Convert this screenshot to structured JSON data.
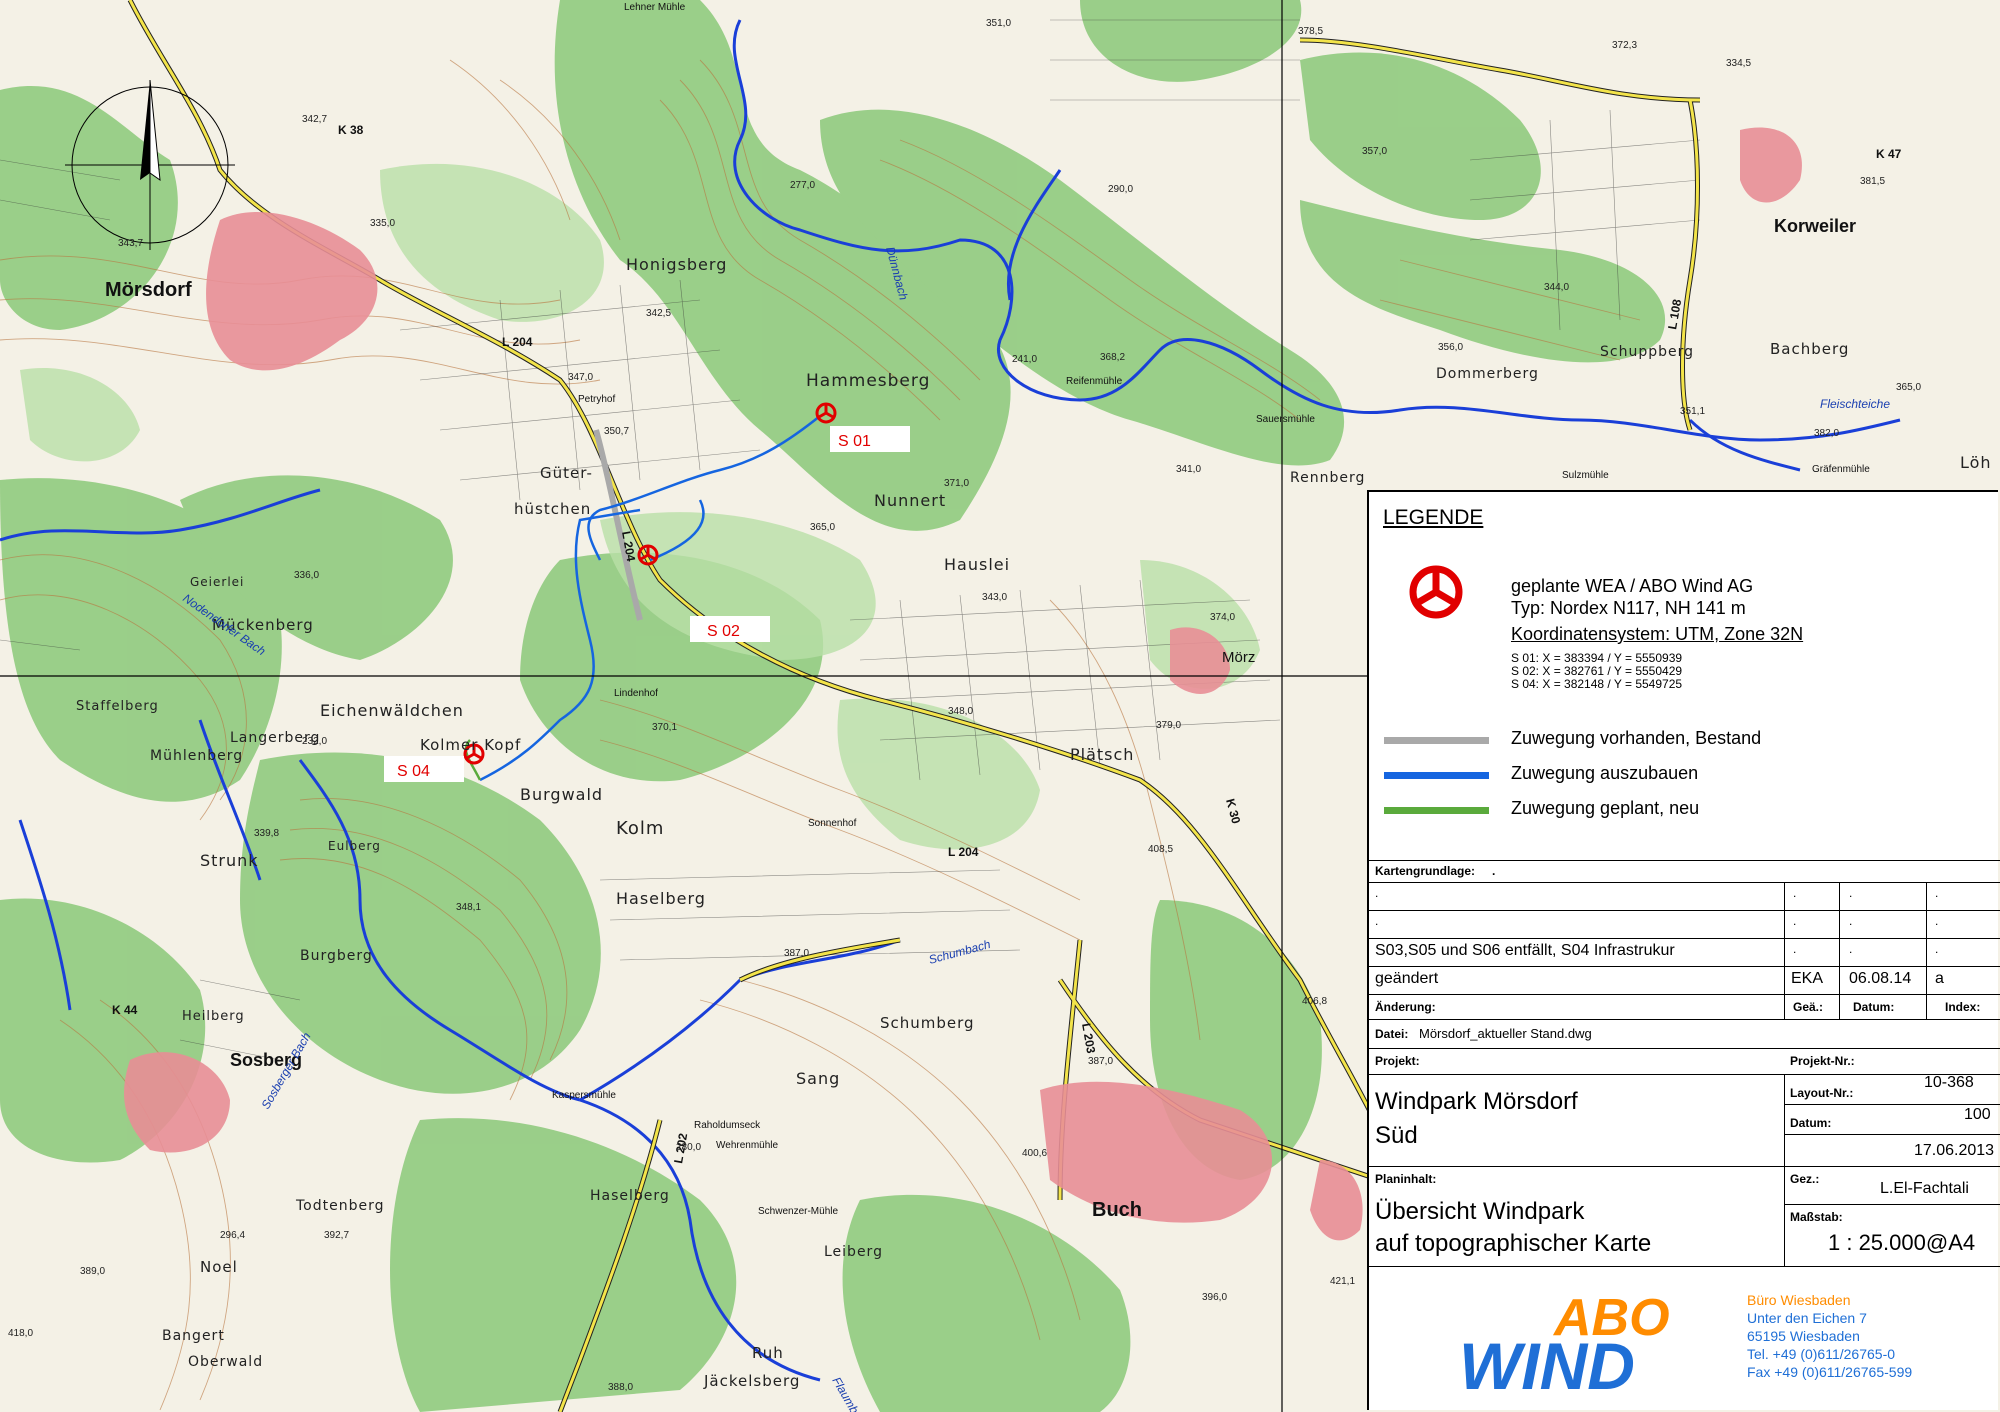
{
  "map": {
    "towns": [
      "Mörsdorf",
      "Korweiler",
      "Sosberg",
      "Buch",
      "Mörz"
    ],
    "places": [
      "Honigsberg",
      "Hammesberg",
      "Güter-",
      "hüstchen",
      "Nunnert",
      "Hauslei",
      "Geierlei",
      "Mückenberg",
      "Eichenwäldchen",
      "Kolmer Kopf",
      "Burgwald",
      "Kolm",
      "Haselberg",
      "Strunk",
      "Mühlenberg",
      "Langerberg",
      "Heilberg",
      "Burgberg",
      "Schumberg",
      "Sang",
      "Haselberg",
      "Todtenberg",
      "Noel",
      "Bangert",
      "Oberwald",
      "Ruh",
      "Jäckelsberg",
      "Leiberg",
      "Plätsch",
      "Rennberg",
      "Bachberg",
      "Schuppberg",
      "Dommerberg",
      "Löh",
      "Staffelberg",
      "Eulberg"
    ],
    "farms": [
      "Petryhof",
      "Lindenhof",
      "Sonnenhof",
      "Reifenmühle",
      "Sauersmühle",
      "Sulzmühle",
      "Gräfenmühle",
      "Kaspersmühle",
      "Raholdumseck",
      "Wehrenmühle",
      "Schwenzer-Mühle",
      "Lehner Mühle"
    ],
    "creeks": [
      "Dünnbach",
      "Schumbach",
      "Sosberger Bach",
      "Flaumbach",
      "Nodendorfer Bach",
      "Fleischteiche"
    ],
    "roads": [
      "L 204",
      "K 38",
      "L 204",
      "L 204",
      "K 47",
      "L 108",
      "K 30",
      "L 203",
      "L 202",
      "K 44"
    ],
    "elevations": [
      "342,7",
      "343,7",
      "335,0",
      "347,0",
      "350,7",
      "342,5",
      "277,0",
      "351,0",
      "378,5",
      "372,3",
      "334,5",
      "357,0",
      "290,0",
      "381,5",
      "344,0",
      "356,0",
      "241,0",
      "368,2",
      "351,1",
      "365,0",
      "341,0",
      "371,0",
      "365,0",
      "343,0",
      "374,0",
      "379,0",
      "348,0",
      "370,1",
      "408,5",
      "339,8",
      "348,1",
      "387,0",
      "406,8",
      "387,0",
      "400,6",
      "280,0",
      "389,0",
      "296,4",
      "392,7",
      "418,0",
      "388,0",
      "421,1",
      "396,0",
      "232,0",
      "336,0",
      "382,0"
    ],
    "sites": [
      {
        "id": "S 01"
      },
      {
        "id": "S 02"
      },
      {
        "id": "S 04"
      }
    ],
    "north_arrow": "north-arrow-icon"
  },
  "legend": {
    "title": "LEGENDE",
    "wea_label": "geplante WEA / ABO Wind AG",
    "wea_type": "Typ: Nordex N117, NH 141 m",
    "coord_system": "Koordinatensystem: UTM, Zone 32N",
    "coords": [
      "S 01: X = 383394 / Y = 5550939",
      "S 02: X = 382761 / Y = 5550429",
      "S 04: X = 382148 / Y = 5549725"
    ],
    "lines": [
      {
        "label": "Zuwegung vorhanden, Bestand",
        "color": "#a9a9a9"
      },
      {
        "label": "Zuwegung auszubauen",
        "color": "#1565e0"
      },
      {
        "label": "Zuwegung geplant, neu",
        "color": "#5aaa3c"
      }
    ],
    "site_color": "#e10000"
  },
  "titleblock": {
    "kartengrundlage_label": "Kartengrundlage:",
    "kartengrundlage_value": ".",
    "rows": [
      {
        "text": ".",
        "gez": ".",
        "datum": ".",
        "index": "."
      },
      {
        "text": ".",
        "gez": ".",
        "datum": ".",
        "index": "."
      },
      {
        "text": "S03,S05 und S06 entfällt, S04 Infrastrukur",
        "gez": ".",
        "datum": ".",
        "index": "."
      },
      {
        "text": "geändert",
        "gez": "EKA",
        "datum": "06.08.14",
        "index": "a"
      }
    ],
    "aenderung_label": "Änderung:",
    "gez_label": "Geä.:",
    "datum_label": "Datum:",
    "index_label": "Index:",
    "datei_label": "Datei:",
    "datei_value": "Mörsdorf_aktueller Stand.dwg",
    "projekt_label": "Projekt:",
    "projekt_line1": "Windpark Mörsdorf",
    "projekt_line2": "Süd",
    "projekt_nr_label": "Projekt-Nr.:",
    "projekt_nr": "10-368",
    "layout_nr_label": "Layout-Nr.:",
    "layout_nr": "100",
    "datum2_label": "Datum:",
    "datum2": "17.06.2013",
    "planinhalt_label": "Planinhalt:",
    "planinhalt_line1": "Übersicht Windpark",
    "planinhalt_line2": "auf topographischer Karte",
    "gez2_label": "Gez.:",
    "gez2": "L.El-Fachtali",
    "massstab_label": "Maßstab:",
    "massstab": "1 : 25.000@A4"
  },
  "company": {
    "logo_top": "ABO",
    "logo_bottom": "WIND",
    "office": "Büro Wiesbaden",
    "street": "Unter den Eichen 7",
    "city": "65195  Wiesbaden",
    "tel": "Tel. +49 (0)611/26765-0",
    "fax": "Fax +49 (0)611/26765-599",
    "orange": "#ff8c00",
    "blue": "#1f6fd6"
  }
}
